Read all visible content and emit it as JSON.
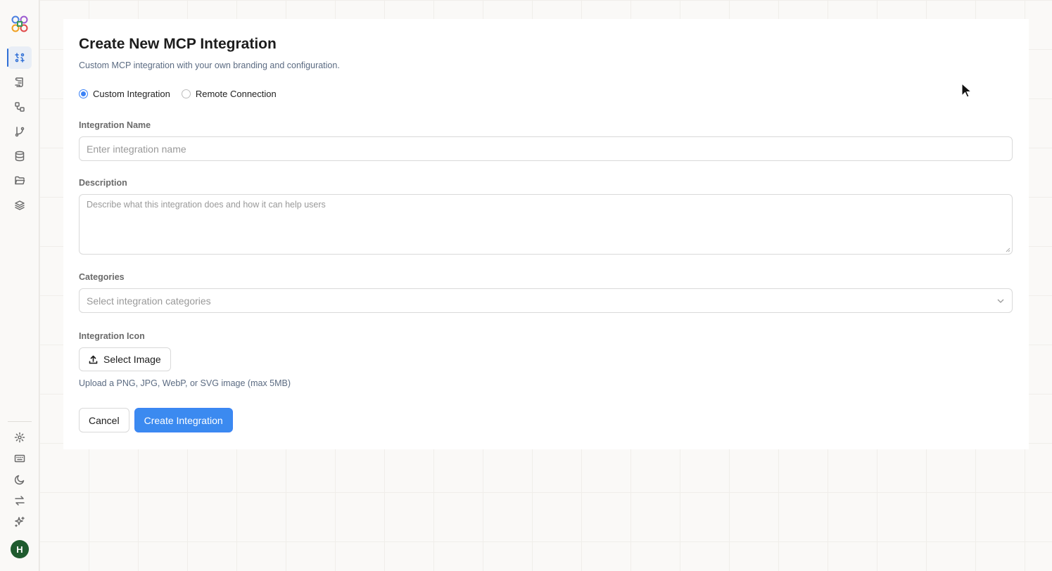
{
  "sidebar": {
    "avatar_initial": "H",
    "nav_icons": [
      "integrations-icon",
      "scroll-icon",
      "workflow-icon",
      "git-branch-icon",
      "database-icon",
      "folder-icon",
      "layers-icon"
    ],
    "bottom_icons": [
      "settings-icon",
      "keyboard-icon",
      "moon-icon",
      "swap-icon",
      "sparkles-icon"
    ]
  },
  "form": {
    "title": "Create New MCP Integration",
    "subtitle": "Custom MCP integration with your own branding and configuration.",
    "radio_options": [
      "Custom Integration",
      "Remote Connection"
    ],
    "selected_radio": "Custom Integration",
    "name_label": "Integration Name",
    "name_placeholder": "Enter integration name",
    "description_label": "Description",
    "description_placeholder": "Describe what this integration does and how it can help users",
    "categories_label": "Categories",
    "categories_placeholder": "Select integration categories",
    "icon_label": "Integration Icon",
    "select_image_label": "Select Image",
    "upload_hint": "Upload a PNG, JPG, WebP, or SVG image (max 5MB)",
    "cancel_label": "Cancel",
    "create_label": "Create Integration"
  },
  "colors": {
    "accent": "#3b82f6",
    "avatar": "#1f5b2e"
  }
}
